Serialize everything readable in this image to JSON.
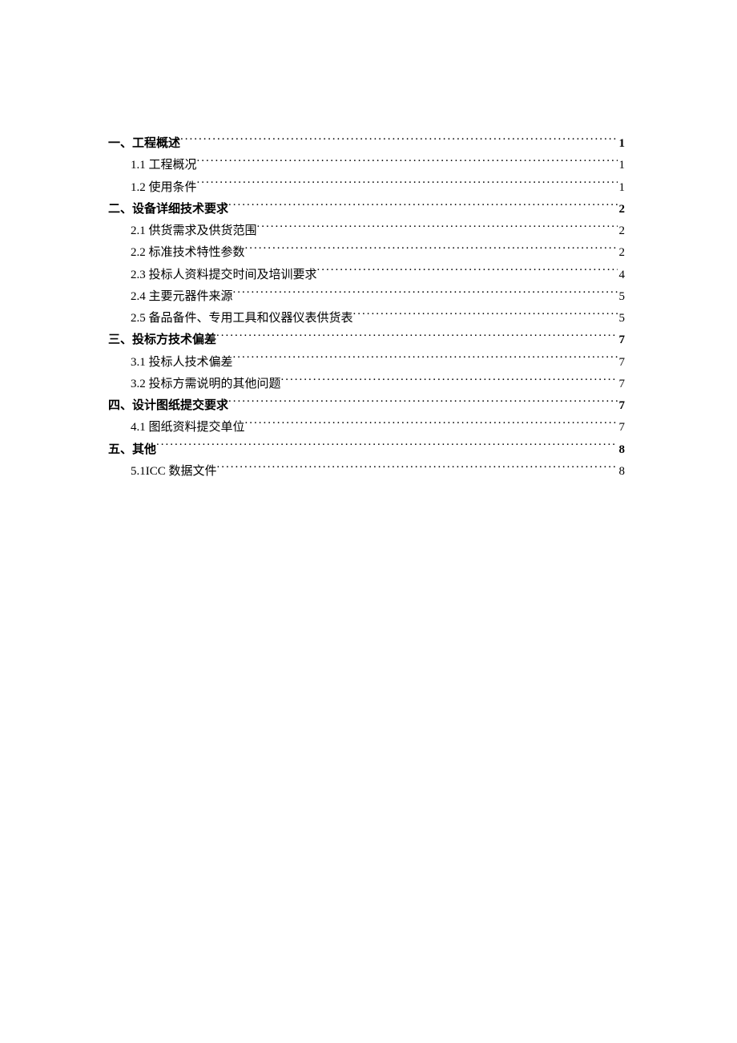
{
  "toc": [
    {
      "level": 1,
      "label": "一、工程概述",
      "page": "1"
    },
    {
      "level": 2,
      "label": "1.1 工程概况",
      "page": "1"
    },
    {
      "level": 2,
      "label": "1.2 使用条件",
      "page": "1"
    },
    {
      "level": 1,
      "label": "二、设备详细技术要求",
      "page": "2"
    },
    {
      "level": 2,
      "label": "2.1 供货需求及供货范围",
      "page": "2"
    },
    {
      "level": 2,
      "label": "2.2 标准技术特性参数",
      "page": "2"
    },
    {
      "level": 2,
      "label": "2.3 投标人资料提交时间及培训要求",
      "page": "4"
    },
    {
      "level": 2,
      "label": "2.4 主要元器件来源",
      "page": "5"
    },
    {
      "level": 2,
      "label": "2.5 备品备件、专用工具和仪器仪表供货表",
      "page": "5"
    },
    {
      "level": 1,
      "label": "三、投标方技术偏差",
      "page": "7"
    },
    {
      "level": 2,
      "label": "3.1 投标人技术偏差",
      "page": "7"
    },
    {
      "level": 2,
      "label": "3.2 投标方需说明的其他问题",
      "page": "7"
    },
    {
      "level": 1,
      "label": "四、设计图纸提交要求",
      "page": "7"
    },
    {
      "level": 2,
      "label": "4.1 图纸资料提交单位",
      "page": "7"
    },
    {
      "level": 1,
      "label": "五、其他",
      "page": "8"
    },
    {
      "level": 2,
      "label": "5.1ICC 数据文件",
      "page": "8"
    }
  ]
}
